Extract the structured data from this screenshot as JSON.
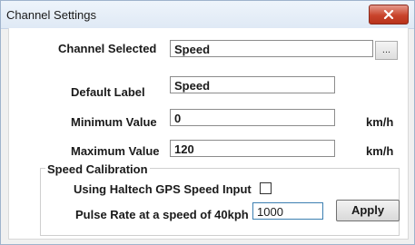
{
  "window": {
    "title": "Channel Settings",
    "close_icon": "close-icon"
  },
  "form": {
    "channel_selected_label": "Channel Selected",
    "channel_selected_value": "Speed",
    "browse_button_label": "...",
    "default_label_label": "Default Label",
    "default_label_value": "Speed",
    "minimum_value_label": "Minimum Value",
    "minimum_value": "0",
    "minimum_unit": "km/h",
    "maximum_value_label": "Maximum Value",
    "maximum_value": "120",
    "maximum_unit": "km/h"
  },
  "speed_calibration": {
    "group_title": "Speed Calibration",
    "gps_checkbox_label": "Using Haltech GPS Speed Input",
    "gps_checkbox_checked": false,
    "pulse_rate_label": "Pulse Rate at a speed of 40kph",
    "pulse_rate_value": "1000",
    "apply_label": "Apply"
  },
  "colors": {
    "close_button": "#c9442c",
    "title_bar": "#dfe9f5"
  }
}
